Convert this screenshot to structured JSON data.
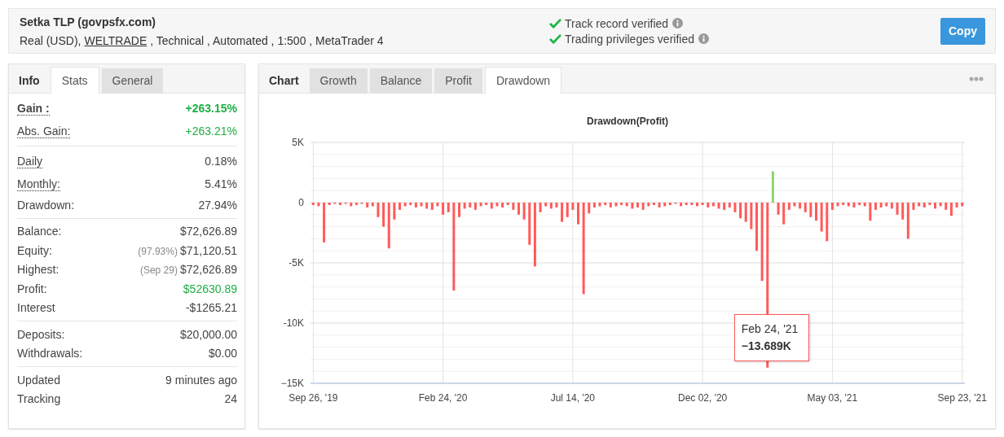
{
  "header": {
    "title": "Setka TLP (govpsfx.com)",
    "details_before": "Real (USD),",
    "broker_link": "WELTRADE",
    "details_after": ", Technical , Automated , 1:500 , MetaTrader 4",
    "verifications": [
      {
        "label": "Track record verified",
        "verified": true
      },
      {
        "label": "Trading privileges verified",
        "verified": true
      }
    ],
    "copy_button": "Copy"
  },
  "stats_panel": {
    "tabs": [
      {
        "label": "Info",
        "kind": "header"
      },
      {
        "label": "Stats",
        "kind": "tab",
        "selected": true
      },
      {
        "label": "General",
        "kind": "tab",
        "selected": false
      }
    ],
    "groups": [
      [
        {
          "label": "Gain :",
          "value": "+263.15%",
          "underlined": true,
          "bold": true,
          "positive": true
        },
        {
          "label": "Abs. Gain:",
          "value": "+263.21%",
          "underlined": true,
          "bold": false,
          "positive": true
        }
      ],
      [
        {
          "label": "Daily",
          "value": "0.18%",
          "underlined": true,
          "bold": false,
          "positive": false
        },
        {
          "label": "Monthly:",
          "value": "5.41%",
          "underlined": true,
          "bold": false,
          "positive": false
        },
        {
          "label": "Drawdown:",
          "value": "27.94%",
          "underlined": false,
          "bold": false,
          "positive": false
        }
      ],
      [
        {
          "label": "Balance:",
          "value": "$72,626.89",
          "underlined": false,
          "bold": false,
          "positive": false
        },
        {
          "label": "Equity:",
          "note": "(97.93%)",
          "value": "$71,120.51",
          "underlined": false,
          "bold": false,
          "positive": false
        },
        {
          "label": "Highest:",
          "note": "(Sep 29)",
          "value": "$72,626.89",
          "underlined": false,
          "bold": false,
          "positive": false
        },
        {
          "label": "Profit:",
          "value": "$52630.89",
          "underlined": false,
          "bold": false,
          "positive": true
        },
        {
          "label": "Interest",
          "value": "-$1265.21",
          "underlined": false,
          "bold": false,
          "positive": false
        }
      ],
      [
        {
          "label": "Deposits:",
          "value": "$20,000.00",
          "underlined": false,
          "bold": false,
          "positive": false
        },
        {
          "label": "Withdrawals:",
          "value": "$0.00",
          "underlined": false,
          "bold": false,
          "positive": false
        }
      ],
      [
        {
          "label": "Updated",
          "value": "9 minutes ago",
          "underlined": false,
          "bold": false,
          "positive": false
        },
        {
          "label": "Tracking",
          "value": "24",
          "underlined": false,
          "bold": false,
          "positive": false
        }
      ]
    ]
  },
  "chart_panel": {
    "tabs": [
      {
        "label": "Chart",
        "kind": "header"
      },
      {
        "label": "Growth",
        "kind": "tab",
        "selected": false
      },
      {
        "label": "Balance",
        "kind": "tab",
        "selected": false
      },
      {
        "label": "Profit",
        "kind": "tab",
        "selected": false
      },
      {
        "label": "Drawdown",
        "kind": "tab",
        "selected": true
      }
    ],
    "chart_data": {
      "type": "bar",
      "title": "Drawdown(Profit)",
      "stacked": true,
      "categories": [
        "Sep 26, '19",
        null,
        null,
        null,
        null,
        null,
        null,
        null,
        null,
        null,
        null,
        null,
        null,
        null,
        null,
        null,
        null,
        null,
        null,
        null,
        null,
        null,
        null,
        null,
        "Feb 24, '20",
        null,
        null,
        null,
        null,
        null,
        null,
        null,
        null,
        null,
        null,
        null,
        null,
        null,
        null,
        null,
        null,
        null,
        null,
        null,
        null,
        null,
        null,
        null,
        "Jul 14, '20",
        null,
        null,
        null,
        null,
        null,
        null,
        null,
        null,
        null,
        null,
        null,
        null,
        null,
        null,
        null,
        null,
        null,
        null,
        null,
        null,
        null,
        null,
        null,
        "Dec 02, '20",
        null,
        null,
        null,
        null,
        null,
        null,
        null,
        null,
        null,
        null,
        null,
        null,
        null,
        null,
        null,
        null,
        null,
        null,
        null,
        null,
        null,
        null,
        null,
        "May 03, '21",
        null,
        null,
        null,
        null,
        null,
        null,
        null,
        null,
        null,
        null,
        null,
        null,
        null,
        null,
        null,
        null,
        null,
        null,
        null,
        null,
        null,
        null,
        null,
        "Sep 23, '21"
      ],
      "series": [
        {
          "color": "#ff5a5a",
          "values": [
            -0.2,
            -0.3,
            -3.3,
            -0.2,
            -0.1,
            -0.2,
            -0.1,
            -0.3,
            -0.2,
            -0.1,
            -0.4,
            -0.3,
            -1.2,
            -2.0,
            -3.8,
            -1.4,
            -0.6,
            -0.3,
            -0.2,
            -0.4,
            -0.3,
            -0.5,
            -0.6,
            -0.3,
            -1.0,
            -0.8,
            -7.3,
            -1.2,
            -0.5,
            -0.4,
            -0.6,
            -0.3,
            -0.2,
            -0.5,
            -0.3,
            -0.4,
            -0.2,
            -0.6,
            -1.0,
            -1.4,
            -3.5,
            -5.3,
            -0.8,
            -0.3,
            -0.5,
            -0.4,
            -1.6,
            -1.2,
            -0.6,
            -1.8,
            -7.6,
            -0.9,
            -0.4,
            -0.3,
            -0.2,
            -0.4,
            -0.3,
            -0.2,
            -0.3,
            -0.5,
            -0.4,
            -0.6,
            -0.3,
            -0.2,
            -0.4,
            -0.3,
            -0.2,
            -0.1,
            -0.3,
            -0.2,
            -0.2,
            -0.3,
            -0.2,
            -0.4,
            -0.3,
            -0.5,
            -0.6,
            -0.4,
            -0.8,
            -1.3,
            -1.6,
            -2.2,
            -4.0,
            -6.5,
            -13.7,
            null,
            -1.0,
            -1.8,
            -0.6,
            -0.3,
            -0.5,
            -0.8,
            -1.2,
            -1.5,
            -2.4,
            -3.2,
            -0.6,
            -0.3,
            -0.2,
            -0.3,
            -0.4,
            -0.2,
            -0.3,
            -1.5,
            -0.6,
            -0.4,
            -0.3,
            -0.5,
            -1.0,
            -1.4,
            -3.0,
            -0.6,
            -0.3,
            -0.4,
            -0.2,
            -0.5,
            -0.3,
            -0.6,
            -1.1,
            -0.4,
            -0.3
          ]
        },
        {
          "color": "#8bd86a",
          "values": [
            null,
            null,
            null,
            null,
            null,
            null,
            null,
            null,
            null,
            null,
            null,
            null,
            null,
            null,
            null,
            null,
            null,
            null,
            null,
            null,
            null,
            null,
            null,
            null,
            null,
            null,
            null,
            null,
            null,
            null,
            null,
            null,
            null,
            null,
            null,
            null,
            null,
            null,
            null,
            null,
            null,
            null,
            null,
            null,
            null,
            null,
            null,
            null,
            null,
            null,
            null,
            null,
            null,
            null,
            null,
            null,
            null,
            null,
            null,
            null,
            null,
            null,
            null,
            null,
            null,
            null,
            null,
            null,
            null,
            null,
            null,
            null,
            null,
            null,
            null,
            null,
            null,
            null,
            null,
            null,
            null,
            null,
            null,
            null,
            null,
            2.6,
            null,
            null,
            null,
            null,
            null,
            null,
            null,
            null,
            null,
            null,
            null,
            null,
            null,
            null,
            null,
            null,
            null,
            null,
            null,
            null,
            null,
            null,
            null,
            null,
            null,
            null,
            null,
            null,
            null,
            null,
            null,
            null,
            null,
            null,
            null
          ]
        }
      ],
      "ylim": [
        -15,
        5
      ],
      "yticks": [
        {
          "value": 5,
          "label": "5K"
        },
        {
          "value": 0,
          "label": "0"
        },
        {
          "value": -5,
          "label": "-5K"
        },
        {
          "value": -10,
          "label": "-10K"
        },
        {
          "value": -15,
          "label": "−15K"
        }
      ],
      "grid": true,
      "annotations": [
        {
          "y": -13.7,
          "text": "Feb 24, '21 **−13.689K**"
        }
      ]
    }
  }
}
